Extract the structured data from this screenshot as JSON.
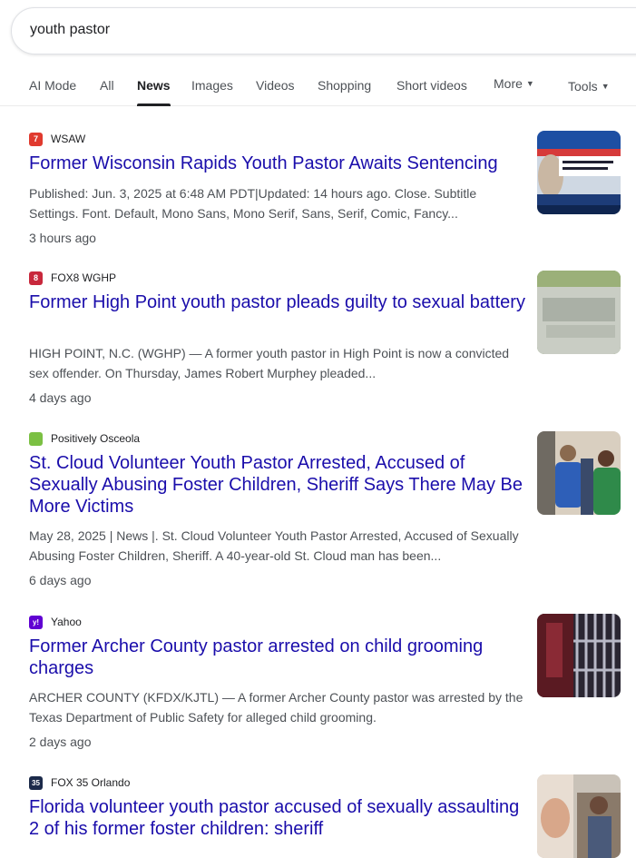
{
  "search": {
    "query": "youth pastor"
  },
  "tabs": [
    {
      "label": "AI Mode"
    },
    {
      "label": "All"
    },
    {
      "label": "News"
    },
    {
      "label": "Images"
    },
    {
      "label": "Videos"
    },
    {
      "label": "Shopping"
    },
    {
      "label": "Short videos"
    },
    {
      "label": "More"
    },
    {
      "label": "Tools"
    }
  ],
  "active_tab": "News",
  "results": [
    {
      "source": "WSAW",
      "favicon_color": "#e03a2e",
      "favicon_text": "7",
      "title": "Former Wisconsin Rapids Youth Pastor Awaits Sentencing",
      "snippet": "Published: Jun. 3, 2025 at 6:48 AM PDT|Updated: 14 hours ago. Close. Subtitle Settings. Font. Default, Mono Sans, Mono Serif, Sans, Serif, Comic, Fancy...",
      "age": "3 hours ago",
      "thumb_icon": "news-broadcast-thumbnail"
    },
    {
      "source": "FOX8 WGHP",
      "favicon_color": "#c8283c",
      "favicon_text": "8",
      "title": "Former High Point youth pastor pleads guilty to sexual battery",
      "snippet": "HIGH POINT, N.C. (WGHP) — A former youth pastor in High Point is now a convicted sex offender. On Thursday, James Robert Murphey pleaded...",
      "age": "4 days ago",
      "thumb_icon": "church-sign-thumbnail"
    },
    {
      "source": "Positively Osceola",
      "favicon_color": "#7bc043",
      "favicon_text": "",
      "title": "St. Cloud Volunteer Youth Pastor Arrested, Accused of Sexually Abusing Foster Children, Sheriff Says There May Be More Victims",
      "snippet": "May 28, 2025 | News |. St. Cloud Volunteer Youth Pastor Arrested, Accused of Sexually Abusing Foster Children, Sheriff. A 40-year-old St. Cloud man has been...",
      "age": "6 days ago",
      "thumb_icon": "arrest-photo-thumbnail"
    },
    {
      "source": "Yahoo",
      "favicon_color": "#6001d2",
      "favicon_text": "y!",
      "title": "Former Archer County pastor arrested on child grooming charges",
      "snippet": "ARCHER COUNTY (KFDX/KJTL) — A former Archer County pastor was arrested by the Texas Department of Public Safety for alleged child grooming.",
      "age": "2 days ago",
      "thumb_icon": "jail-cell-thumbnail"
    },
    {
      "source": "FOX 35 Orlando",
      "favicon_color": "#1c2a4a",
      "favicon_text": "35",
      "title": "Florida volunteer youth pastor accused of sexually assaulting 2 of his former foster children: sheriff",
      "snippet": "",
      "age": "",
      "thumb_icon": "mugshot-thumbnail"
    }
  ]
}
